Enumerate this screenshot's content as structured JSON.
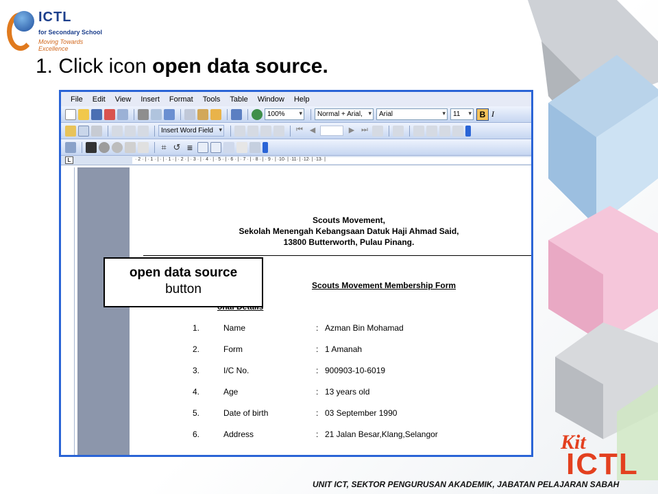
{
  "logo": {
    "title": "ICTL",
    "line1": "for Secondary School",
    "line2": "Moving Towards Excellence"
  },
  "heading": {
    "prefix": "1. Click icon ",
    "bold": "open data source."
  },
  "menu": [
    "File",
    "Edit",
    "View",
    "Insert",
    "Format",
    "Tools",
    "Table",
    "Window",
    "Help"
  ],
  "toolbar": {
    "zoom": "100%",
    "style": "Normal + Arial,",
    "font": "Arial",
    "size": "11",
    "bold": "B",
    "italic": "I",
    "insert_word_field": "Insert Word Field"
  },
  "ruler_marks": "· 2 · | · 1 · | · | · 1 · | · 2 · | · 3 · | · 4 · | · 5 · | · 6 · | · 7 · | · 8 · | · 9 · | ·10· | ·11· | ·12· | ·13· |",
  "document": {
    "address": [
      "Scouts Movement,",
      "Sekolah Menengah Kebangsaan Datuk Haji Ahmad Said,",
      "13800 Butterworth, Pulau Pinang."
    ],
    "form_title": "Scouts Movement Membership Form",
    "section": "onal Details",
    "rows": [
      {
        "n": "1.",
        "label": "Name",
        "value": "Azman Bin Mohamad"
      },
      {
        "n": "2.",
        "label": "Form",
        "value": "1 Amanah"
      },
      {
        "n": "3.",
        "label": "I/C No.",
        "value": "900903-10-6019"
      },
      {
        "n": "4.",
        "label": "Age",
        "value": "13 years old"
      },
      {
        "n": "5.",
        "label": "Date of birth",
        "value": "03 September 1990"
      },
      {
        "n": "6.",
        "label": "Address",
        "value": "21 Jalan Besar,Klang,Selangor"
      }
    ]
  },
  "callout": {
    "line1": "open data source",
    "line2": "button"
  },
  "footer": "UNIT ICT, SEKTOR PENGURUSAN AKADEMIK, JABATAN PELAJARAN SABAH",
  "brand": {
    "kit": "Kit",
    "ictl": "ICTL"
  },
  "colors": {
    "accent": "#2a64d6",
    "brand": "#e3401f"
  }
}
